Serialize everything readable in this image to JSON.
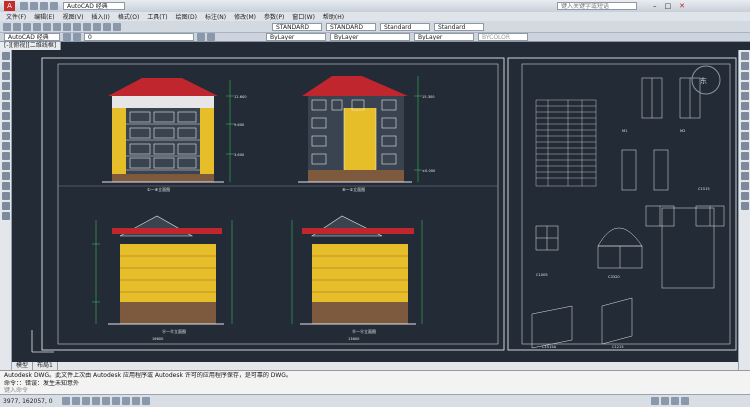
{
  "window": {
    "title": "AutoCAD 经典",
    "search_placeholder": "键入关键字或短语"
  },
  "menus": [
    "文件(F)",
    "编辑(E)",
    "视图(V)",
    "插入(I)",
    "格式(O)",
    "工具(T)",
    "绘图(D)",
    "标注(N)",
    "修改(M)",
    "参数(P)",
    "窗口(W)",
    "帮助(H)"
  ],
  "toolbar": {
    "workspace": "AutoCAD 经典",
    "layer": "0",
    "text_style": "STANDARD",
    "dim_style": "STANDARD",
    "table_style": "Standard",
    "multileader_style": "Standard",
    "color": "ByLayer",
    "linetype": "ByLayer",
    "lineweight": "ByLayer",
    "plot_style": "BYCOLOR"
  },
  "doc_tab": "[-][俯视][二维线框]",
  "tabs": [
    "模型",
    "布局1"
  ],
  "command_history": [
    "Autodesk DWG。此文件上次由 Autodesk 应用程序或 Autodesk 许可的应用程序保存，是可靠的 DWG。",
    "命令：：错误：发生未知意外"
  ],
  "prompt": "键入命令",
  "status": {
    "coords": "3977, 162057, 0"
  },
  "drawing": {
    "title_a": "①—⑧立面图",
    "title_b": "⑧—①立面图",
    "title_c": "Ⓐ—Ⓓ立面图",
    "title_d": "Ⓓ—Ⓐ立面图",
    "scale": "1:100",
    "windows": [
      "C1005",
      "C1515",
      "C1215",
      "C1515A",
      "C3320"
    ],
    "door_labels": [
      "M1",
      "M2"
    ],
    "dims": [
      "12.600",
      "9.600",
      "6.600",
      "3.600",
      "±0.000",
      "-0.450",
      "15.300",
      "2.450",
      "3300",
      "16600",
      "13600"
    ]
  },
  "colors": {
    "canvas": "#222b36",
    "roof": "#c0262e",
    "wall": "#e6be2a",
    "base": "#7d5a3e",
    "line": "#e6e6e6",
    "green": "#3fd060"
  }
}
